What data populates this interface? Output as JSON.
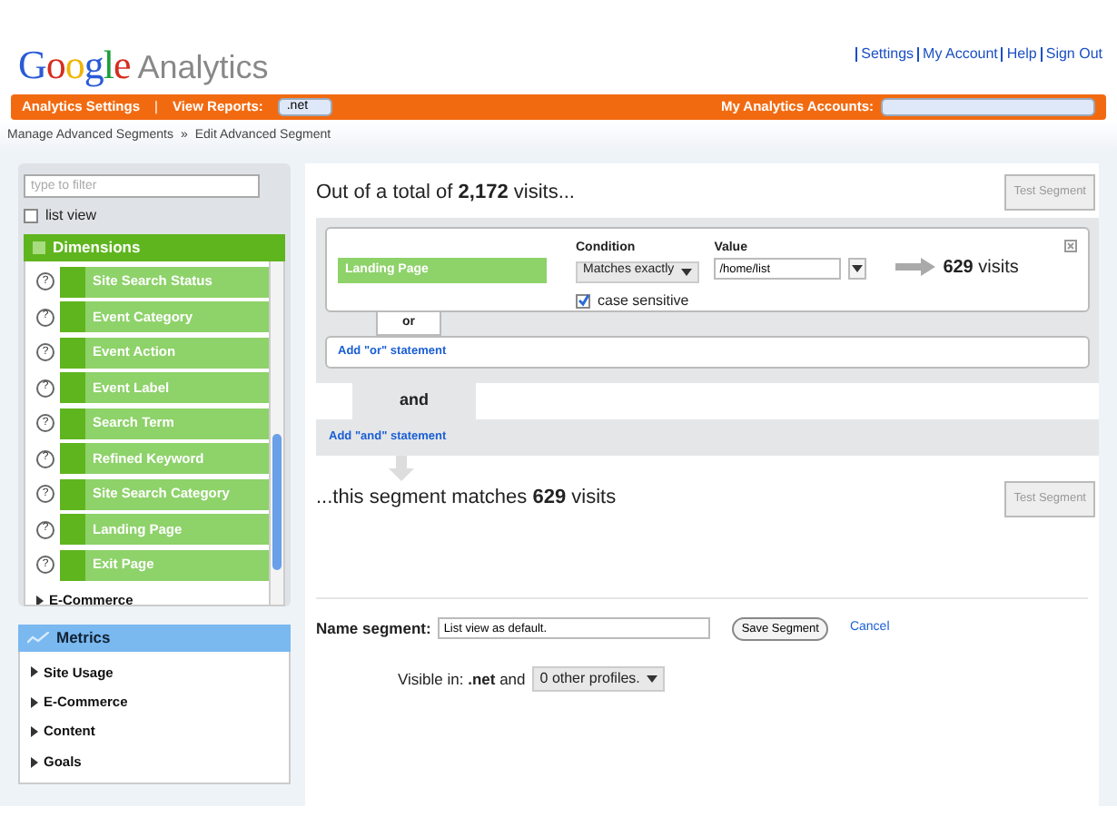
{
  "logo": {
    "brand": "Google",
    "product": "Analytics"
  },
  "header_links": [
    "Settings",
    "My Account",
    "Help",
    "Sign Out"
  ],
  "top_bar": {
    "settings_link": "Analytics Settings",
    "separator": "|",
    "view_reports_label": "View Reports:",
    "view_reports_value": ".net",
    "accounts_label": "My Analytics Accounts:"
  },
  "breadcrumb": {
    "items": [
      "Manage Advanced Segments",
      "Edit Advanced Segment"
    ],
    "separator": "»"
  },
  "sidebar": {
    "filter": {
      "placeholder": "type to filter"
    },
    "list_view": {
      "label": "list view",
      "checked": false
    },
    "dimensions": {
      "title": "Dimensions",
      "items": [
        {
          "help": "?",
          "label": "Site Search Status"
        },
        {
          "help": "?",
          "label": "Event Category"
        },
        {
          "help": "?",
          "label": "Event Action"
        },
        {
          "help": "?",
          "label": "Event Label"
        },
        {
          "help": "?",
          "label": "Search Term"
        },
        {
          "help": "?",
          "label": "Refined Keyword"
        },
        {
          "help": "?",
          "label": "Site Search Category"
        },
        {
          "help": "?",
          "label": "Landing Page"
        },
        {
          "help": "?",
          "label": "Exit Page"
        }
      ],
      "groups": [
        {
          "label": "E-Commerce",
          "expanded": false
        }
      ]
    },
    "metrics": {
      "title": "Metrics",
      "groups": [
        {
          "label": "Site Usage",
          "expanded": false
        },
        {
          "label": "E-Commerce",
          "expanded": false
        },
        {
          "label": "Content",
          "expanded": false
        },
        {
          "label": "Goals",
          "expanded": false
        }
      ]
    }
  },
  "main": {
    "total": "Out of a total of **2,172** visits...",
    "test_button": "Test Segment",
    "condition": {
      "dimension": "Landing Page",
      "condition_label": "Condition",
      "condition_value": "Matches exactly",
      "value_label": "Value",
      "value": "/home/list",
      "case_sensitive": {
        "label": "case sensitive",
        "checked": true
      },
      "result": "**629** visits"
    },
    "or_label": "or",
    "add_or": "Add \"or\" statement",
    "and_label": "and",
    "add_and": "Add \"and\" statement",
    "matches": "...this segment matches **629** visits",
    "test_button_2": "Test Segment",
    "name_label": "Name segment:",
    "name_value": "List view as default.",
    "save_button": "Save Segment",
    "cancel_link": "Cancel",
    "visible": "Visible in: **.net** and",
    "profiles": "0 other profiles."
  }
}
